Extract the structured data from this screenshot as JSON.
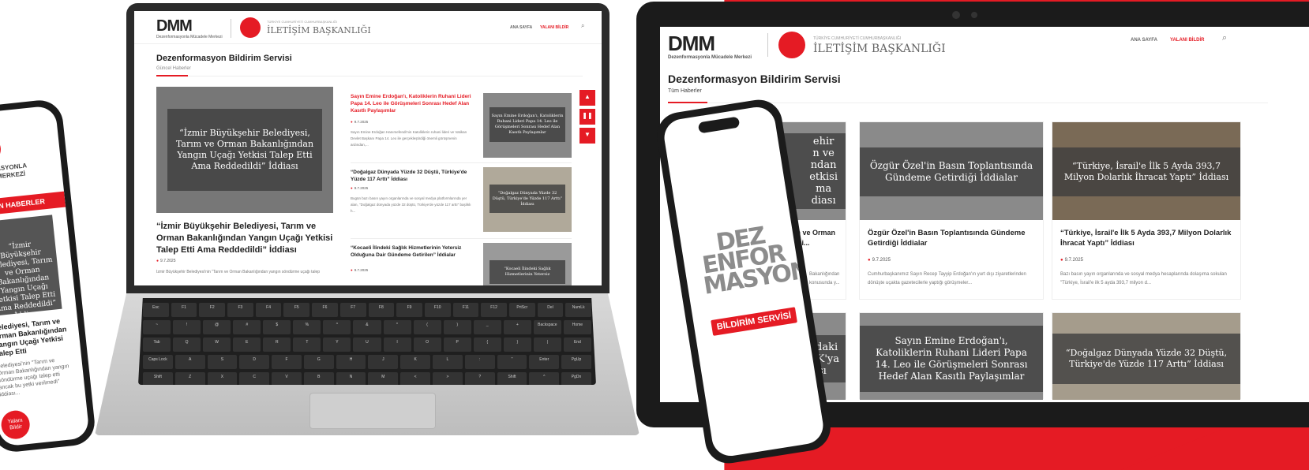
{
  "brand": {
    "dmm": "DMM",
    "dmm_sub": "Dezenformasyonla Mücadele Merkezi",
    "gov_top": "TÜRKİYE CUMHURİYETİ CUMHURBAŞKANLIĞI",
    "gov": "İLETİŞİM BAŞKANLIĞI"
  },
  "nav": {
    "home": "ANA SAYFA",
    "report": "YALANI BİLDİR"
  },
  "laptop": {
    "section_title": "Dezenformasyon Bildirim Servisi",
    "section_sub": "Güncel Haberler",
    "featured": {
      "overlay": "“İzmir Büyükşehir Belediyesi, Tarım ve Orman Bakanlığından Yangın Uçağı Yetkisi Talep Etti Ama Reddedildi” İddiası",
      "headline": "“İzmir Büyükşehir Belediyesi, Tarım ve Orman Bakanlığından Yangın Uçağı Yetkisi Talep Etti Ama Reddedildi” İddiası",
      "date": "9.7.2025",
      "excerpt": "İzmir Büyükşehir Belediyesi'nin \"Tarım ve Orman Bakanlığından yangın söndürme uçağı talep"
    },
    "items": [
      {
        "headline": "Sayın Emine Erdoğan'ı, Katoliklerin Ruhani Lideri Papa 14. Leo ile Görüşmeleri Sonrası Hedef Alan Kasıtlı Paylaşımlar",
        "date": "9.7.2025",
        "excerpt": "Sayın Emine Erdoğan Hanımefendi'nin Katoliklerin ruhani lideri ve Vatikan Devlet Başkanı Papa 14. Leo ile gerçekleştirdiği önemli görüşmenin ardından,...",
        "thumb": "Sayın Emine Erdoğan'ı, Katoliklerin Ruhani Lideri Papa 14. Leo ile Görüşmeleri Sonrası Hedef Alan Kasıtlı Paylaşımlar"
      },
      {
        "headline": "“Doğalgaz Dünyada Yüzde 32 Düştü, Türkiye'de Yüzde 117 Arttı” İddiası",
        "date": "9.7.2025",
        "excerpt": "Bugün bazı basın yayın organlarında ve sosyal medya platformlarında yer alan, \"Doğalgaz dünyada yüzde 32 düştü, Türkiye'de yüzde 117 arttı\" başlıklı h...",
        "thumb": "“Doğalgaz Dünyada Yüzde 32 Düştü, Türkiye'de Yüzde 117 Arttı” İddiası"
      },
      {
        "headline": "“Kocaeli İlindeki Sağlık Hizmetlerinin Yetersiz Olduğuna Dair Gündeme Getirilen” İddialar",
        "date": "9.7.2025",
        "thumb": "“Kocaeli İlindeki Sağlık Hizmetlerinin Yetersiz"
      }
    ],
    "keys_row1": [
      "Esc",
      "F1",
      "F2",
      "F3",
      "F4",
      "F5",
      "F6",
      "F7",
      "F8",
      "F9",
      "F10",
      "F11",
      "F12",
      "PrtScr",
      "Del",
      "NumLk"
    ],
    "keys_row2": [
      "~",
      "!",
      "@",
      "#",
      "$",
      "%",
      "^",
      "&",
      "*",
      "(",
      ")",
      "_",
      "+",
      "Backspace",
      "Home"
    ],
    "keys_row3": [
      "Tab",
      "Q",
      "W",
      "E",
      "R",
      "T",
      "Y",
      "U",
      "I",
      "O",
      "P",
      "{",
      "}",
      "|",
      "End"
    ],
    "keys_row4": [
      "Caps Lock",
      "A",
      "S",
      "D",
      "F",
      "G",
      "H",
      "J",
      "K",
      "L",
      ":",
      "\"",
      "Enter",
      "PgUp"
    ],
    "keys_row5": [
      "Shift",
      "Z",
      "X",
      "C",
      "V",
      "B",
      "N",
      "M",
      "<",
      ">",
      "?",
      "Shift",
      "^",
      "PgDn"
    ],
    "keys_row6": [
      "Ctrl",
      "Fn",
      "Alt",
      "",
      "Alt",
      "",
      "Ctrl",
      "<",
      "v",
      ">"
    ]
  },
  "tablet": {
    "section_title": "Dezenformasyon Bildirim Servisi",
    "section_sub": "Tüm Haberler",
    "cards": [
      {
        "overlay": "Özgür Özel'in Basın Toplantısında Gündeme Getirdiği İddialar",
        "headline": "Özgür Özel'in Basın Toplantısında Gündeme Getirdiği İddialar",
        "date": "9.7.2025",
        "excerpt": "Cumhurbaşkanımız Sayın Recep Tayyip Erdoğan'ın yurt dışı ziyaretlerinden dönüşte uçakta gazetecilerle yaptığı görüşmeler..."
      },
      {
        "overlay": "“Türkiye, İsrail'e İlk 5 Ayda 393,7 Milyon Dolarlık İhracat Yaptı” İddiası",
        "headline": "“Türkiye, İsrail'e İlk 5 Ayda 393,7 Milyon Dolarlık İhracat Yaptı” İddiası",
        "date": "9.7.2025",
        "excerpt": "Bazı basın yayın organlarında ve sosyal medya hesaplarında dolaşıma sokulan \"Türkiye, İsrail'e ilk 5 ayda 393,7 milyon d..."
      },
      {
        "overlay": "Sayın Emine Erdoğan'ı, Katoliklerin Ruhani Lideri Papa 14. Leo ile Görüşmeleri Sonrası Hedef Alan Kasıtlı Paylaşımlar"
      },
      {
        "overlay": "“Doğalgaz Dünyada Yüzde 32 Düştü, Türkiye'de Yüzde 117 Arttı” İddiası"
      }
    ],
    "partial_left_overlay": "ehir\nn ve\nndan\netkisi\nma\ndiası",
    "partial_left_headline": "arım ve Orman\netkisi...",
    "partial_left_excerpt": "Bakanlığından\nkonusunda y...",
    "partial_left_overlay2": "atay'daki\nn, PKK'ya\ndiası"
  },
  "phone_left": {
    "title": "FORMASYONLA\nDELE MERKEZİ",
    "bar": "YALAN HABERLER",
    "card": "“İzmir Büyükşehir Belediyesi, Tarım ve Orman Bakanlığından Yangın Uçağı Yetkisi Talep Etti Ama Reddedildi” İddiası",
    "headline": "Belediyesi, Tarım ve Orman Bakanlığından Yangın Uçağı Yetkisi Talep Etti",
    "excerpt": "Belediyesi'nin \"Tarım ve Orman Bakanlığından yangın söndürme uçağı talep etti ancak bu yetki verilmedi\" iddiası...",
    "button": "Yalanı Bildir"
  },
  "phone_right": {
    "logo": "DEZ ENFOR MASYON",
    "badge": "BİLDİRİM SERVİSİ"
  },
  "colors": {
    "accent": "#e51b24",
    "dark": "#1b1b1b"
  }
}
